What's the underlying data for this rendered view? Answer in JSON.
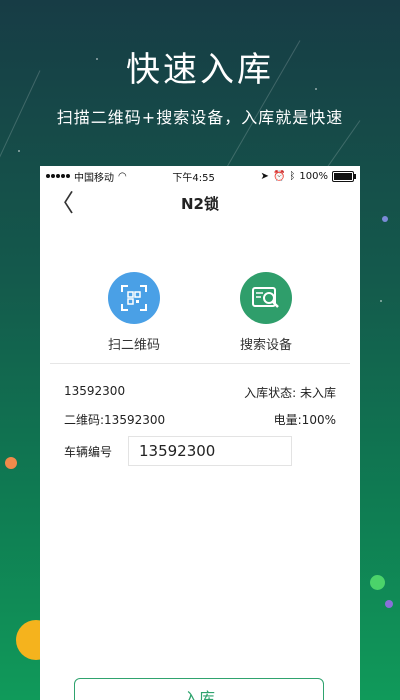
{
  "hero": {
    "title": "快速入库",
    "subtitle": "扫描二维码+搜索设备，入库就是快速"
  },
  "status_bar": {
    "carrier": "中国移动",
    "time": "下午4:55",
    "battery": "100%"
  },
  "nav": {
    "back": "〈",
    "title": "N2锁"
  },
  "actions": [
    {
      "label": "扫二维码",
      "icon": "qr-scan-icon",
      "color": "#4aa0e6"
    },
    {
      "label": "搜索设备",
      "icon": "search-device-icon",
      "color": "#2f9e6b"
    }
  ],
  "device": {
    "id": "13592300",
    "status_label": "入库状态: 未入库",
    "qr_code": "二维码:13592300",
    "battery_level": "电量:100%"
  },
  "vehicle": {
    "label": "车辆编号",
    "value": "13592300"
  },
  "submit_label": "入库",
  "colors": {
    "accent_green": "#2fa36e",
    "accent_blue": "#4aa0e6",
    "background_top": "#173c45",
    "background_bottom": "#109a5a"
  }
}
